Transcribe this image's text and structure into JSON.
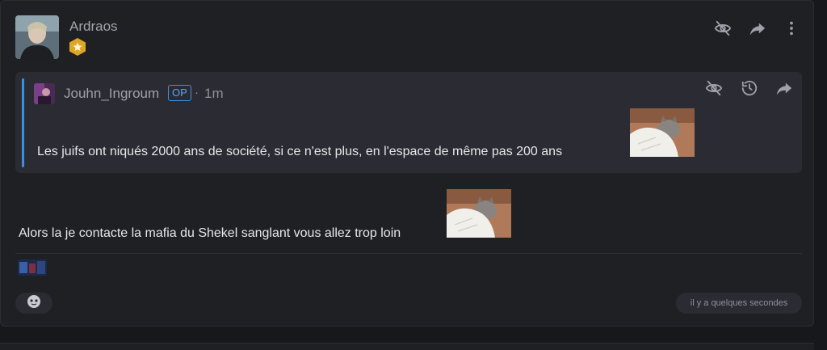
{
  "post": {
    "author": "Ardraos",
    "text": "Alors la je contacte la mafia du Shekel sanglant vous allez trop loin",
    "timestamp": "il y a quelques secondes"
  },
  "quote": {
    "author": "Jouhn_Ingroum",
    "op_label": "OP",
    "separator": "·",
    "time": "1m",
    "text": "Les juifs ont niqués 2000 ans de société, si ce n'est plus, en l'espace de même pas 200 ans"
  },
  "icons": {
    "hide": "eye-slash-icon",
    "share": "share-icon",
    "more": "more-vertical-icon",
    "history": "history-icon",
    "badge": "star-hexagon-icon",
    "reaction": "emoji-icon"
  },
  "colors": {
    "accent": "#3b8fe0",
    "badge": "#e0a526",
    "background": "#1f2024",
    "quote_background": "#2b2c33"
  }
}
